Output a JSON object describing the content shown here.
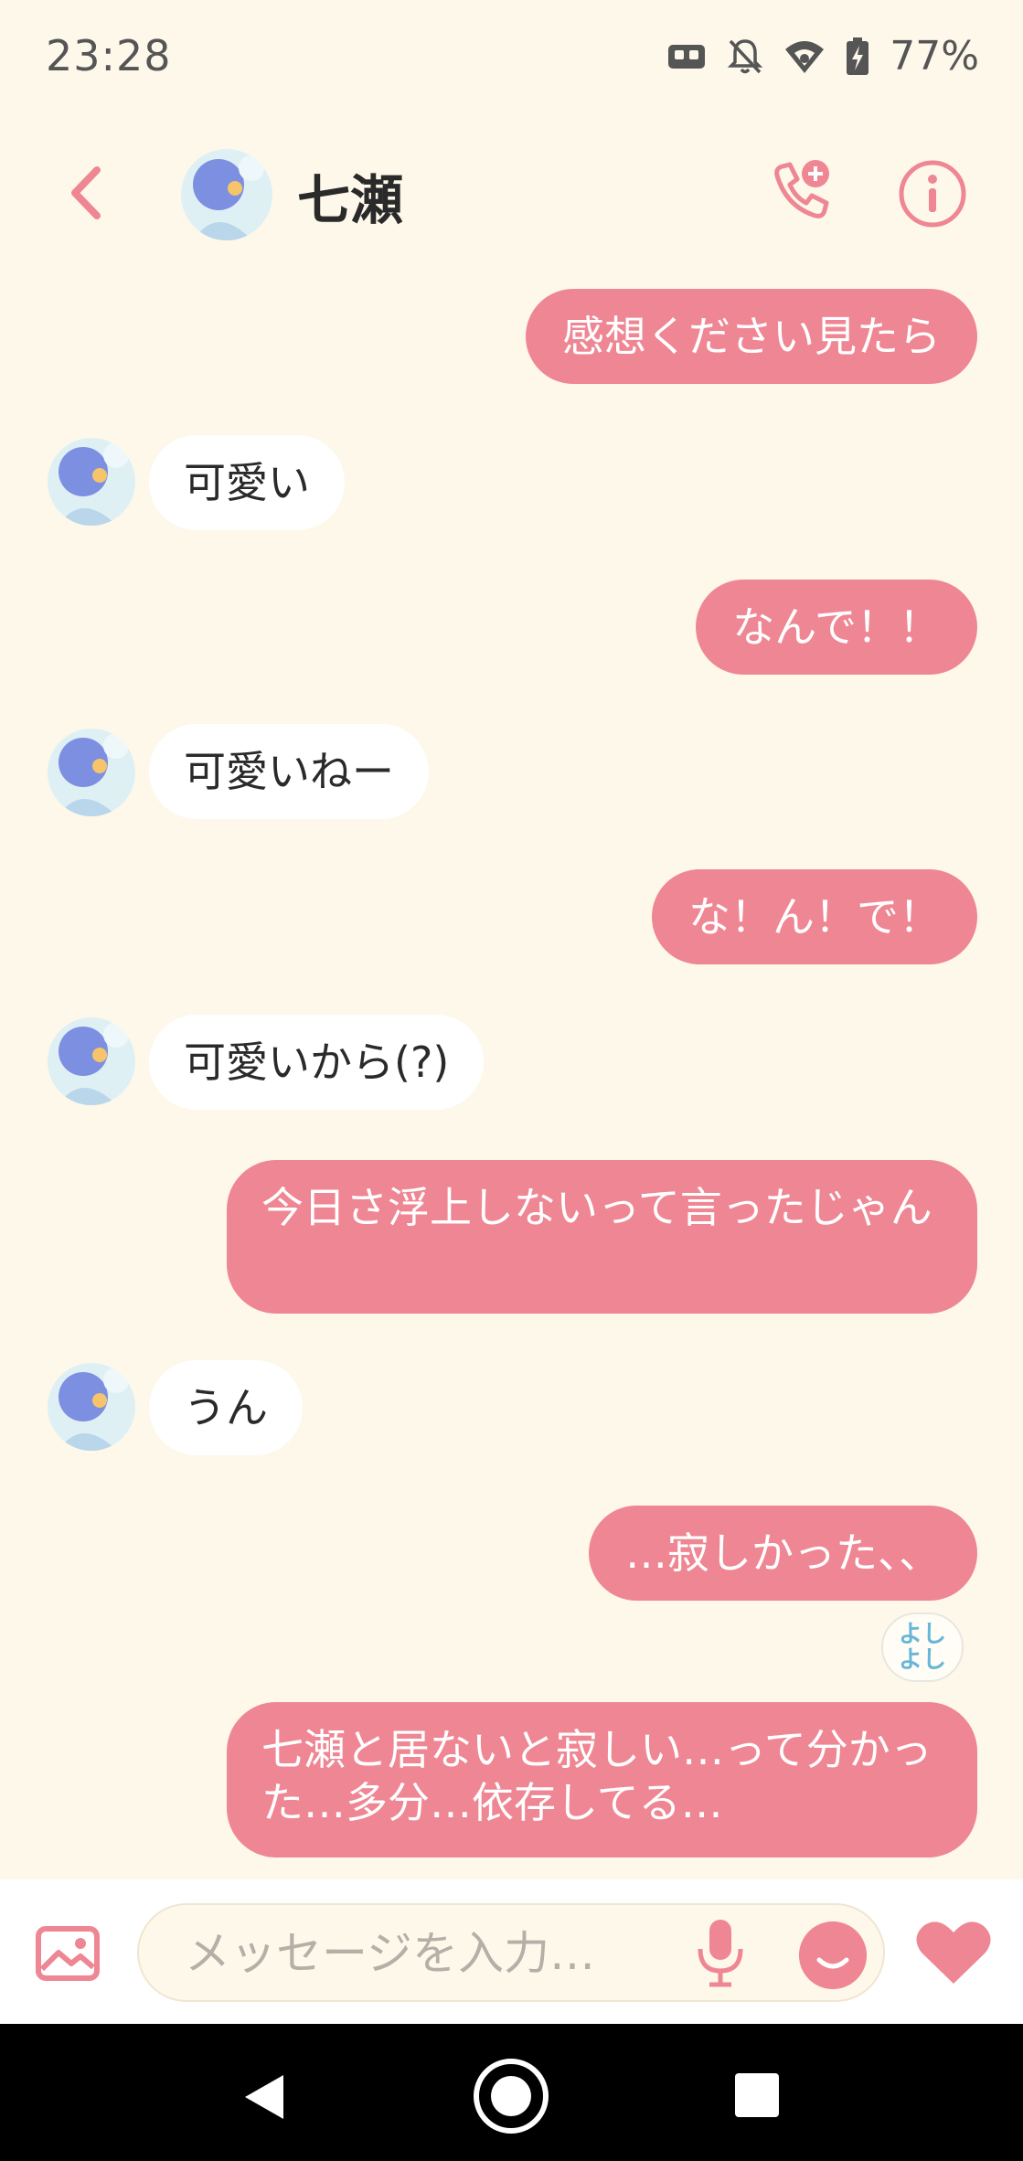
{
  "status_bar": {
    "time": "23:28",
    "battery": "77%",
    "icons": [
      "game-controller-icon",
      "bell-off-icon",
      "wifi-icon",
      "battery-charging-icon"
    ]
  },
  "header": {
    "contact_name": "七瀬",
    "icons": [
      "back-chevron-icon",
      "avatar",
      "add-call-icon",
      "info-icon"
    ]
  },
  "messages": [
    {
      "side": "out",
      "text": "感想ください見たら"
    },
    {
      "side": "in",
      "text": "可愛い"
    },
    {
      "side": "out",
      "text": "なんで！！"
    },
    {
      "side": "in",
      "text": "可愛いねー"
    },
    {
      "side": "out",
      "text": "な！ん！で！"
    },
    {
      "side": "in",
      "text": "可愛いから(?)"
    },
    {
      "side": "out",
      "text": "今日さ浮上しないって言ったじゃん"
    },
    {
      "side": "in",
      "text": "うん"
    },
    {
      "side": "out",
      "text": "…寂しかった、、",
      "reaction": {
        "line1": "よし",
        "line2": "よし"
      }
    },
    {
      "side": "out",
      "text": "七瀬と居ないと寂しい…って分かった…多分…依存してる…"
    }
  ],
  "input_bar": {
    "placeholder": "メッセージを入力…",
    "icons": [
      "image-icon",
      "microphone-icon",
      "smiley-icon",
      "heart-icon"
    ]
  },
  "colors": {
    "background": "#fdf8ea",
    "outgoing_bubble": "#ef8693",
    "incoming_bubble": "#ffffff",
    "accent": "#ef8693"
  }
}
